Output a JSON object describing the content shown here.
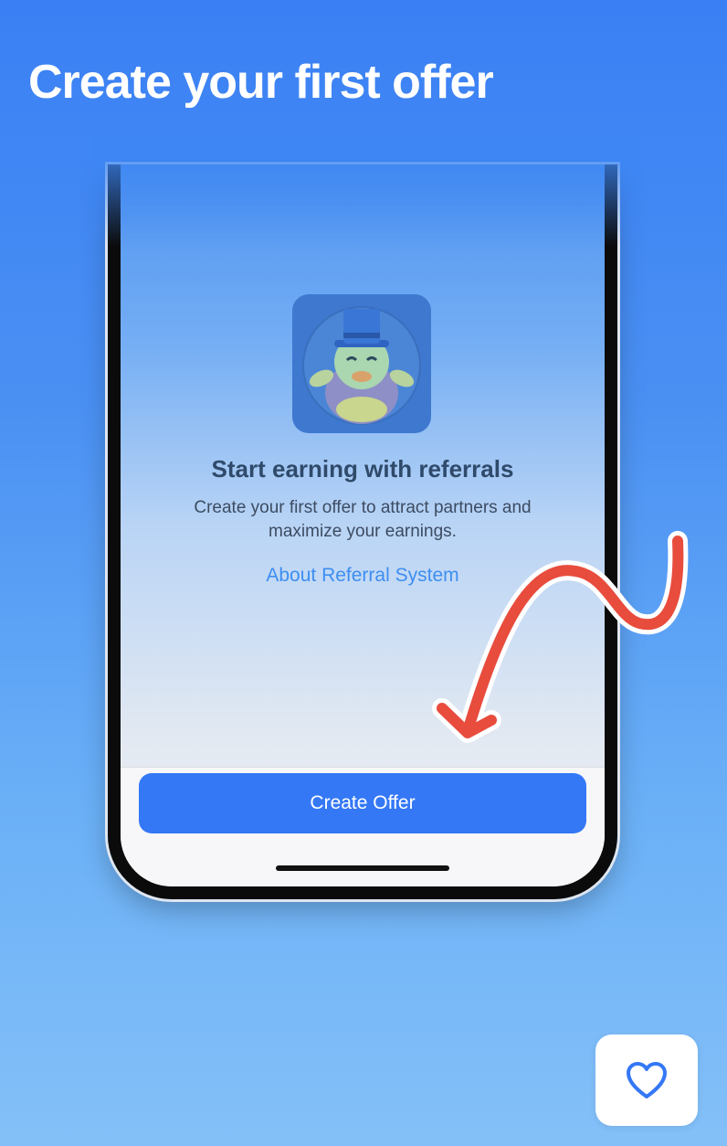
{
  "header": {
    "title": "Create your first offer"
  },
  "phone": {
    "empty_state": {
      "icon": "duck-mascot-top-hat",
      "title": "Start earning with referrals",
      "description": "Create your first offer to attract partners and maximize your earnings.",
      "link_label": "About Referral System"
    },
    "primary_button_label": "Create Offer"
  },
  "overlay": {
    "arrow": "red-curved-arrow-icon",
    "arrow_color": "#e84c3d"
  },
  "floating_action": {
    "icon": "heart-icon"
  },
  "colors": {
    "accent": "#3478f6",
    "link": "#3d8ef1",
    "background_top": "#3a80f4",
    "background_bottom": "#84c0f8"
  }
}
